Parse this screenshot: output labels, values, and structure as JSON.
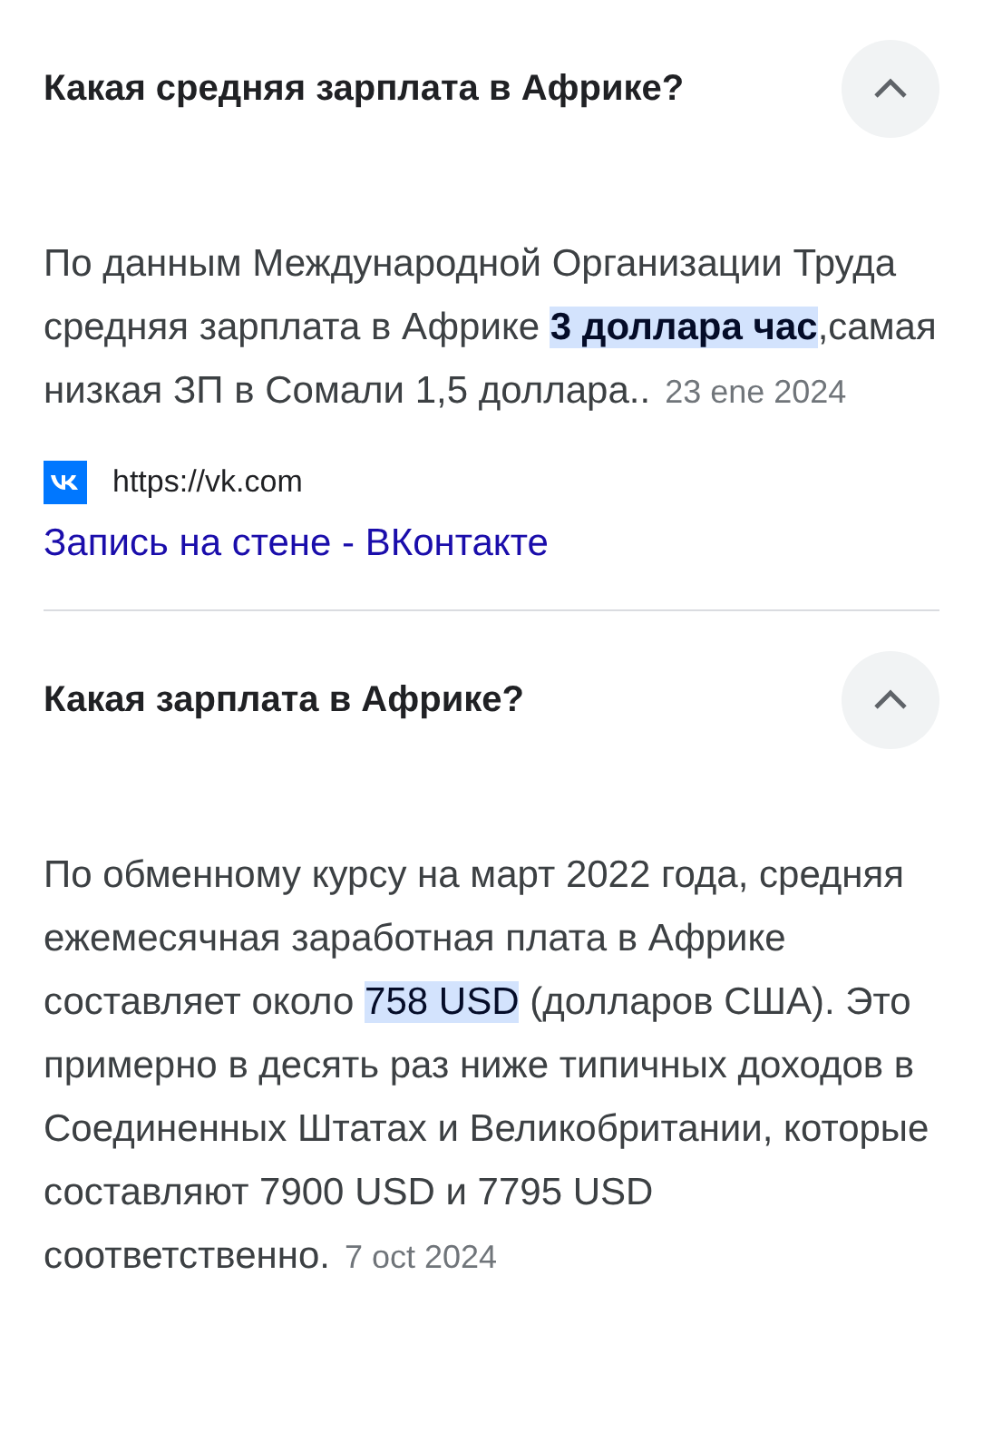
{
  "questions": [
    {
      "question": "Какая средняя зарплата в Африке?",
      "expanded": true,
      "answer": [
        {
          "text": "По данным Международной Организации Труда средняя зарплата в Африке ",
          "highlighted": false
        },
        {
          "text": "**3 доллара час**",
          "highlighted": true
        },
        {
          "text": ",самая низкая ЗП в Сомали 1,5 доллара..",
          "highlighted": false
        }
      ],
      "date": "23 ene 2024",
      "source": {
        "url": "https://vk.com",
        "title": "Запись на стене - ВКонтакте"
      }
    },
    {
      "question": "Какая зарплата в Африке?",
      "expanded": true,
      "answer": [
        {
          "text": "По обменному курсу на март 2022 года, средняя ежемесячная заработная плата в Африке составляет около ",
          "highlighted": false
        },
        {
          "text": "758 USD",
          "highlighted": true
        },
        {
          "text": " (долларов США). Это примерно в десять раз ниже типичных доходов в Соединенных Штатах и Великобритании, которые составляют 7900 USD и 7795 USD соответственно.",
          "highlighted": false
        }
      ],
      "date": "7 oct 2024"
    }
  ]
}
